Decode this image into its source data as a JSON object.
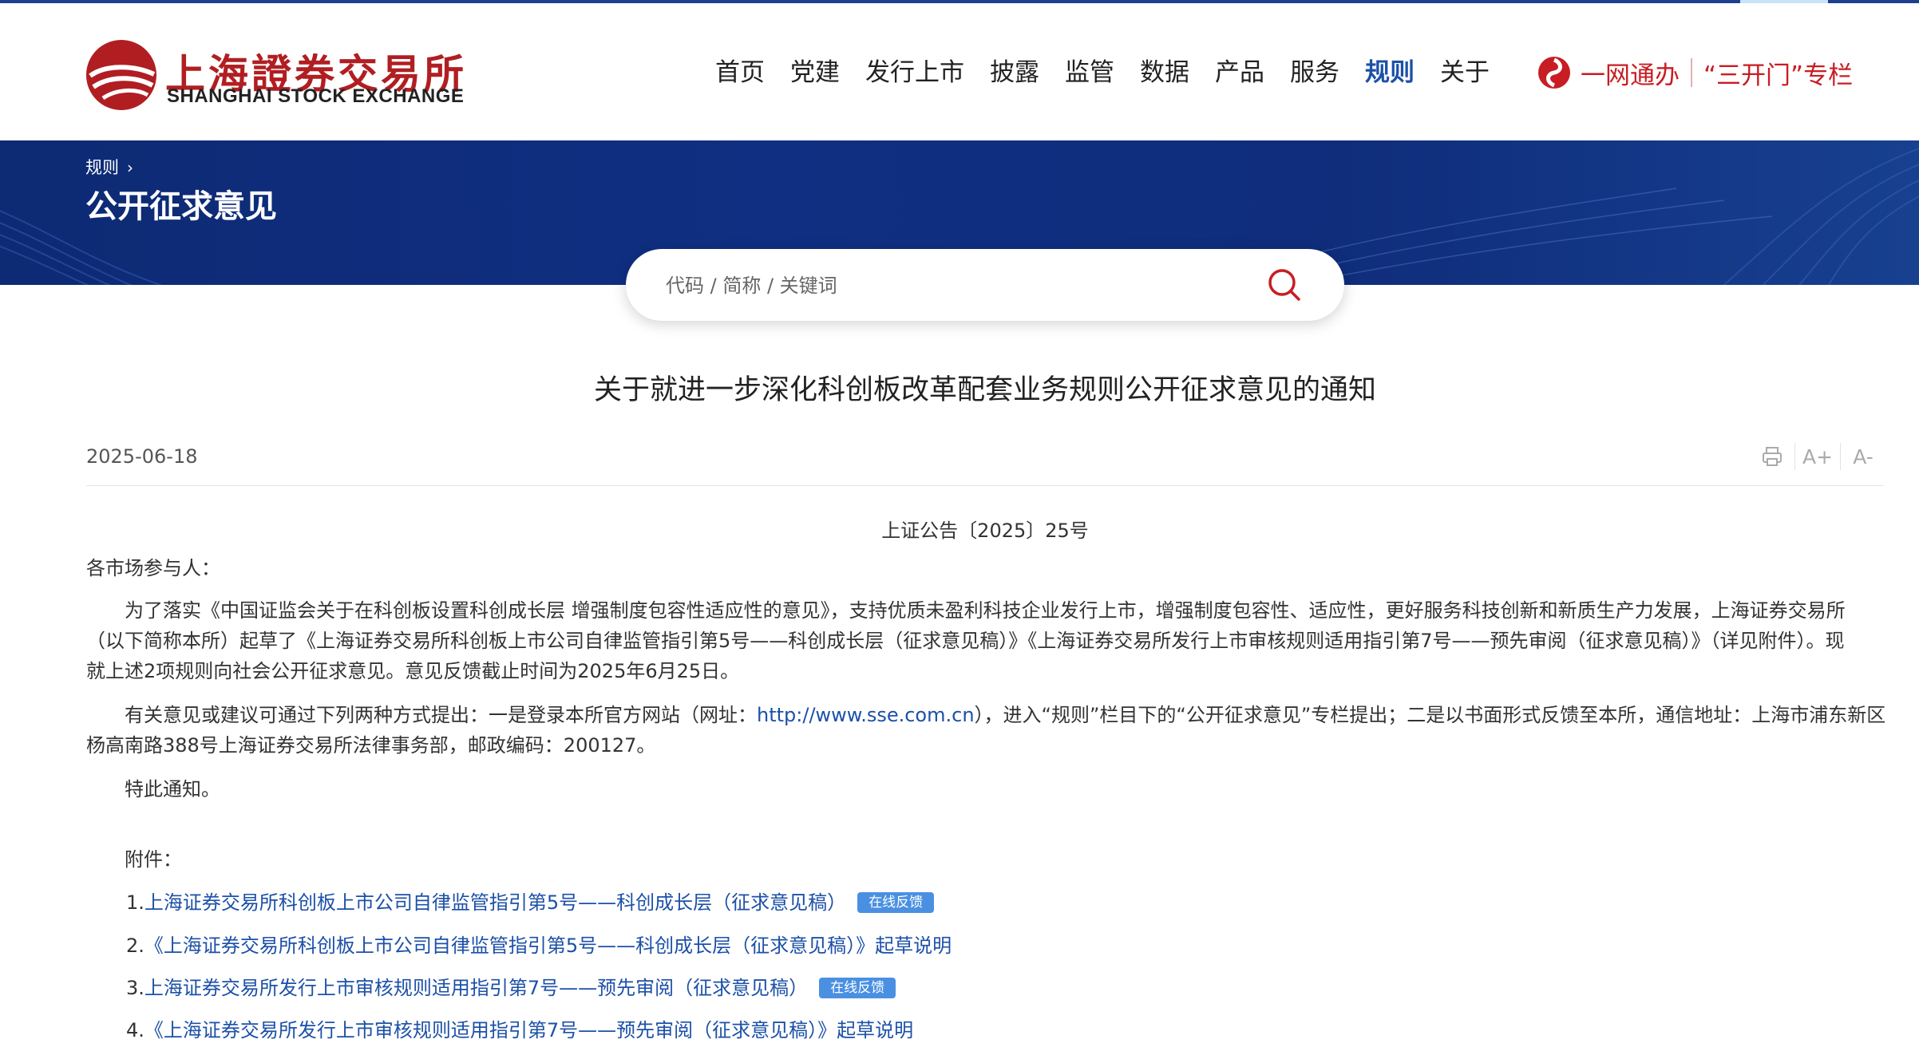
{
  "logo": {
    "name_cn": "上海證券交易所",
    "name_en": "SHANGHAI STOCK EXCHANGE"
  },
  "nav": {
    "items": [
      {
        "label": "首页"
      },
      {
        "label": "党建"
      },
      {
        "label": "发行上市"
      },
      {
        "label": "披露"
      },
      {
        "label": "监管"
      },
      {
        "label": "数据"
      },
      {
        "label": "产品"
      },
      {
        "label": "服务"
      },
      {
        "label": "规则",
        "active": true
      },
      {
        "label": "关于"
      }
    ]
  },
  "services": {
    "one_net": "一网通办",
    "three_doors": "“三开门”专栏"
  },
  "banner": {
    "breadcrumb": "规则",
    "title": "公开征求意见"
  },
  "search": {
    "placeholder": "代码 / 简称 / 关键词"
  },
  "article": {
    "title": "关于就进一步深化科创板改革配套业务规则公开征求意见的通知",
    "date": "2025-06-18",
    "doc_no": "上证公告〔2025〕25号",
    "salutation": "各市场参与人：",
    "para1": [
      "为了落实《中国证监会关于在科创板设置科创成长层 增强制度包容性适应性的意见》，支持优质未盈利科技企业发行上市，增强制度包容性、适应性，更好服务科技创新和新质生产力发展，上海证券交易所",
      "（以下简称本所）起草了《上海证券交易所科创板上市公司自律监管指引第5号——科创成长层（征求意见稿）》《上海证券交易所发行上市审核规则适用指引第7号——预先审阅（征求意见稿）》（详见附件）。现",
      "就上述2项规则向社会公开征求意见。意见反馈截止时间为2025年6月25日。"
    ],
    "para2_a": "有关意见或建议可通过下列两种方式提出：一是登录本所官方网站（网址：",
    "para2_url": "http://www.sse.com.cn",
    "para2_b": "），进入“规则”栏目下的“公开征求意见”专栏提出；二是以书面形式反馈至本所，通信地址：上海市浦东新区",
    "para2_c": "杨高南路388号上海证券交易所法律事务部，邮政编码：200127。",
    "closing": "特此通知。",
    "attachments_label": "附件：",
    "attachments": [
      {
        "num": "1.",
        "text": "上海证券交易所科创板上市公司自律监管指引第5号——科创成长层（征求意见稿）",
        "badge": "在线反馈"
      },
      {
        "num": "2.",
        "text": "《上海证券交易所科创板上市公司自律监管指引第5号——科创成长层（征求意见稿）》起草说明",
        "badge": ""
      },
      {
        "num": "3.",
        "text": "上海证券交易所发行上市审核规则适用指引第7号——预先审阅（征求意见稿）",
        "badge": "在线反馈"
      },
      {
        "num": "4.",
        "text": "《上海证券交易所发行上市审核规则适用指引第7号——预先审阅（征求意见稿）》起草说明",
        "badge": ""
      }
    ]
  },
  "tools": {
    "icons": [
      "print-icon",
      "font-increase-icon",
      "font-decrease-icon"
    ],
    "increase_label": "A+",
    "decrease_label": "A-"
  },
  "colors": {
    "brand_red": "#c81d22",
    "nav_active": "#1c50a8",
    "banner_blue": "#102f82",
    "link_blue": "#1c50a8",
    "badge_blue": "#4a90e2"
  }
}
